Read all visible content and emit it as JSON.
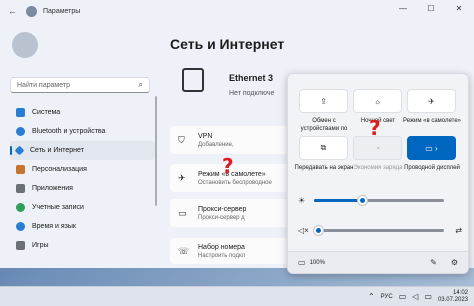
{
  "window": {
    "title": "Параметры",
    "controls": [
      "—",
      "☐",
      "✕"
    ]
  },
  "search": {
    "placeholder": "Найти параметр"
  },
  "sidebar": {
    "items": [
      {
        "label": "Система",
        "icon": "system-icon",
        "color": "#2b7cd3"
      },
      {
        "label": "Bluetooth и устройства",
        "icon": "bluetooth-icon",
        "color": "#2b7cd3"
      },
      {
        "label": "Сеть и Интернет",
        "icon": "network-icon",
        "color": "#2b7cd3",
        "active": true
      },
      {
        "label": "Персонализация",
        "icon": "personalization-icon",
        "color": "#c8742c"
      },
      {
        "label": "Приложения",
        "icon": "apps-icon",
        "color": "#6a6f78"
      },
      {
        "label": "Учетные записи",
        "icon": "accounts-icon",
        "color": "#2e9f5b"
      },
      {
        "label": "Время и язык",
        "icon": "time-icon",
        "color": "#2b7cd3"
      },
      {
        "label": "Игры",
        "icon": "games-icon",
        "color": "#6a6f78"
      }
    ]
  },
  "main": {
    "title": "Сеть и Интернет",
    "ethernet": {
      "name": "Ethernet 3",
      "status": "Нет подключе"
    },
    "cards": [
      {
        "title": "VPN",
        "subtitle": "Добавление,",
        "icon": "shield-icon"
      },
      {
        "title": "Режим «в самолете»",
        "subtitle": "Остановить беспроводное",
        "icon": "airplane-icon"
      },
      {
        "title": "Прокси-сервер",
        "subtitle": "Прокси-сервер д",
        "icon": "proxy-icon"
      },
      {
        "title": "Набор номера",
        "subtitle": "Настроить подкл",
        "icon": "dialup-icon"
      }
    ]
  },
  "quick_settings": {
    "tiles": [
      {
        "label": "Обмен с устройствами по",
        "icon": "share-icon",
        "state": "off"
      },
      {
        "label": "Ночной свет",
        "icon": "night-light-icon",
        "state": "off"
      },
      {
        "label": "Режим «в самолете»",
        "icon": "airplane-icon",
        "state": "off"
      },
      {
        "label": "Передавать на экран",
        "icon": "cast-icon",
        "state": "off"
      },
      {
        "label": "Экономия заряда",
        "icon": "battery-saver-icon",
        "state": "disabled"
      },
      {
        "label": "Проводной дисплей",
        "icon": "wired-display-icon",
        "state": "on"
      }
    ],
    "brightness": {
      "icon": "brightness-icon",
      "value": 0.37
    },
    "volume": {
      "icon": "volume-mute-icon",
      "value": 0.03
    },
    "battery_percent": "100%",
    "question_marks": [
      "?",
      "?"
    ]
  },
  "taskbar": {
    "lang": "РУС",
    "time": "14:02",
    "date": "03.07.2023"
  },
  "colors": {
    "accent": "#0067c0",
    "annotation": "#e01b1b"
  }
}
